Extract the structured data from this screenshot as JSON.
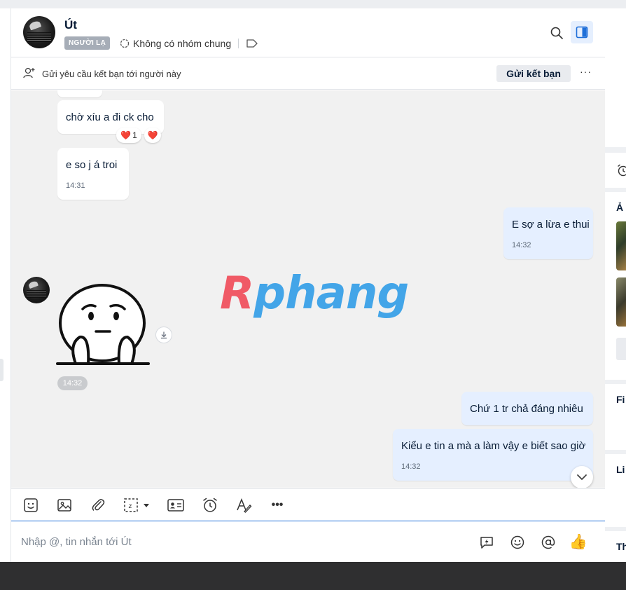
{
  "chat": {
    "contact_name": "Út",
    "stranger_badge": "NGƯỜI LẠ",
    "group_info": "Không có nhóm chung",
    "friend_request_text": "Gửi yêu cầu kết bạn tới người này",
    "send_friend_button": "Gửi kết bạn",
    "more_label": "···"
  },
  "messages": [
    {
      "id": "m1",
      "from": "them",
      "text": "chờ xíu a đi ck cho",
      "reactions": [
        {
          "emoji": "❤️",
          "count": "1"
        },
        {
          "emoji": "❤️",
          "count": ""
        }
      ]
    },
    {
      "id": "m2",
      "from": "them",
      "text": "e so j á troi",
      "time": "14:31"
    },
    {
      "id": "m3",
      "from": "me",
      "text": "E sợ a lừa e thui",
      "time": "14:32"
    },
    {
      "id": "m4",
      "from": "them",
      "type": "sticker",
      "time": "14:32"
    },
    {
      "id": "m5",
      "from": "me",
      "text": "Chứ 1 tr chả đáng nhiêu"
    },
    {
      "id": "m6",
      "from": "me",
      "text": "Kiểu e tin a mà a làm vậy e biết sao giờ",
      "time": "14:32"
    }
  ],
  "watermark": {
    "first": "R",
    "rest": "phang"
  },
  "toolbar": {
    "icons": [
      "sticker-icon",
      "image-icon",
      "attachment-icon",
      "screenshot-icon",
      "contact-card-icon",
      "reminder-icon",
      "text-format-icon",
      "more-icon"
    ],
    "more_label": "•••"
  },
  "composer": {
    "placeholder": "Nhập @, tin nhắn tới Út",
    "like_emoji": "👍"
  },
  "side_panel": {
    "media_label": "Ả",
    "files_label": "Fi",
    "links_label": "Li",
    "settings_label": "Th"
  },
  "colors": {
    "accent": "#1e6fd9",
    "my_bubble": "#e5efff",
    "their_bubble": "#ffffff",
    "chat_background": "#f1f1f1",
    "watermark_red": "#f05a66",
    "watermark_blue": "#43a5e8"
  }
}
